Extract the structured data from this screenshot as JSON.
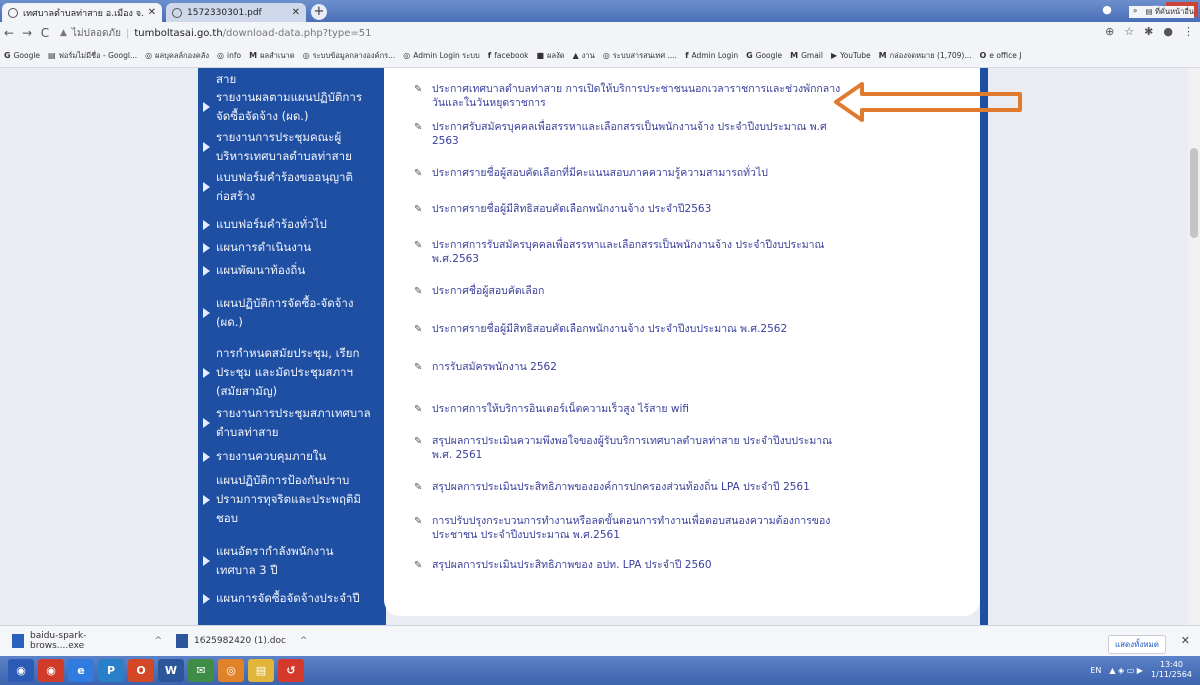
{
  "browser": {
    "tabs": [
      {
        "title": "เทศบาลตำบลท่าสาย อ.เมือง จ.เชียงราย",
        "active": true
      },
      {
        "title": "1572330301.pdf",
        "active": false
      }
    ],
    "new_tab": "+",
    "window_controls": {
      "minimize": "–",
      "maximize": "□",
      "close": "✕"
    },
    "toolbar": {
      "back": "←",
      "forward": "→",
      "reload": "C",
      "warning": "▲",
      "not_secure": "ไม่ปลอดภัย",
      "separator": "|",
      "url_host": "tumboltasai.go.th",
      "url_path": "/download-data.php?type=51",
      "icons": [
        "⊕",
        "☆",
        "✱",
        "●",
        "⋮"
      ]
    },
    "bookmarks": [
      {
        "icon": "G",
        "label": "Google"
      },
      {
        "icon": "▤",
        "label": "ฟอร์มไม่มีชื่อ - Googl..."
      },
      {
        "icon": "◎",
        "label": "ผลบุคลล์กองคลัง"
      },
      {
        "icon": "◎",
        "label": "info"
      },
      {
        "icon": "M",
        "label": "ผลสำเนาด"
      },
      {
        "icon": "◎",
        "label": "ระบบข้อมูลกลางองค์กร..."
      },
      {
        "icon": "◎",
        "label": "Admin Login ระบบ"
      },
      {
        "icon": "f",
        "label": "facebook"
      },
      {
        "icon": "■",
        "label": "ผลงัด"
      },
      {
        "icon": "▲",
        "label": "งาน"
      },
      {
        "icon": "◎",
        "label": "ระบบสารสนเทศ ...."
      },
      {
        "icon": "f",
        "label": "Admin Login"
      },
      {
        "icon": "G",
        "label": "Google"
      },
      {
        "icon": "M",
        "label": "Gmail"
      },
      {
        "icon": "▶",
        "label": "YouTube"
      },
      {
        "icon": "M",
        "label": "กล่องจดหมาย (1,709)..."
      },
      {
        "icon": "O",
        "label": "e office J"
      }
    ],
    "bookmarks_more": "»",
    "bookmarks_other": "▤ ที่คั่นหน้าอื่น"
  },
  "sidebar": {
    "items": [
      {
        "lines": [
          "สาย"
        ],
        "arrow": false
      },
      {
        "lines": [
          "รายงานผลตามแผนปฏิบัติการ",
          "จัดซื้อจัดจ้าง (ผด.)"
        ],
        "arrow": true
      },
      {
        "lines": [
          "รายงานการประชุมคณะผู้",
          "บริหารเทศบาลตำบลท่าสาย"
        ],
        "arrow": true
      },
      {
        "lines": [
          "แบบฟอร์มคำร้องขออนุญาติ",
          "ก่อสร้าง"
        ],
        "arrow": true
      },
      {
        "lines": [
          "แบบฟอร์มคำร้องทั่วไป"
        ],
        "arrow": true
      },
      {
        "lines": [
          "แผนการดำเนินงาน"
        ],
        "arrow": true
      },
      {
        "lines": [
          "แผนพัฒนาท้องถิ่น"
        ],
        "arrow": true
      },
      {
        "lines": [
          "แผนปฏิบัติการจัดซื้อ-จัดจ้าง",
          "(ผด.)"
        ],
        "arrow": true
      },
      {
        "lines": [
          "การกำหนดสมัยประชุม, เรียก",
          "ประชุม และมัดประชุมสภาฯ",
          "(สมัยสามัญ)"
        ],
        "arrow": true
      },
      {
        "lines": [
          "รายงานการประชุมสภาเทศบาล",
          "ตำบลท่าสาย"
        ],
        "arrow": true
      },
      {
        "lines": [
          "รายงานควบคุมภายใน"
        ],
        "arrow": true
      },
      {
        "lines": [
          "แผนปฏิบัติการป้องกันปราบ",
          "ปรามการทุจริตและประพฤติมิ",
          "ชอบ"
        ],
        "arrow": true
      },
      {
        "lines": [
          "แผนอัตรากำลังพนักงาน",
          "เทศบาล 3 ปี"
        ],
        "arrow": true
      },
      {
        "lines": [
          "แผนการจัดซื้อจัดจ้างประจำปี"
        ],
        "arrow": true
      }
    ]
  },
  "announcements": {
    "edit_icon": "✎",
    "items": [
      "ประกาศเทศบาลตำบลท่าสาย การเปิดให้บริการประชาชนนอกเวลาราชการและช่วงพักกลางวันและในวันหยุดราชการ",
      "ประกาศรับสมัครบุคคลเพื่อสรรหาและเลือกสรรเป็นพนักงานจ้าง ประจำปีงบประมาณ พ.ศ 2563",
      "ประกาศรายชื่อผู้สอบคัดเลือกที่มีคะแนนสอบภาคความรู้ความสามารถทั่วไป",
      "ประกาศรายชื่อผู้มีสิทธิสอบคัดเลือกพนักงานจ้าง ประจำปี2563",
      "ประกาศการรับสมัครบุคคลเพื่อสรรหาและเลือกสรรเป็นพนักงานจ้าง ประจำปีงบประมาณ พ.ศ.2563",
      "ประกาศชื่อผู้สอบคัดเลือก",
      "ประกาศรายชื่อผู้มีสิทธิสอบคัดเลือกพนักงานจ้าง ประจำปีงบประมาณ พ.ศ.2562",
      "การรับสมัครพนักงาน 2562",
      "ประกาศการให้บริการอินเตอร์เน็ตความเร็วสูง ไร้สาย wifi",
      "สรุปผลการประเมินความพึงพอใจของผู้รับบริการเทศบาลตำบลท่าสาย ประจำปีงบประมาณ พ.ศ. 2561",
      "สรุปผลการประเมินประสิทธิภาพขององค์การปกครองส่วนท้องถิ่น LPA ประจำปี 2561",
      "การปรับปรุงกระบวนการทำงานหรือลดขั้นตอนการทำงานเพื่อตอบสนองความต้องการของประชาชน ประจำปีงบประมาณ พ.ศ.2561",
      "สรุปผลการประเมินประสิทธิภาพของ อปท. LPA ประจำปี 2560"
    ]
  },
  "downloads": {
    "items": [
      {
        "name": "baidu-spark-brows....exe"
      },
      {
        "name": "1625982420 (1).doc"
      }
    ],
    "chevron": "^",
    "show_all": "แสดงทั้งหมด",
    "close": "✕"
  },
  "taskbar": {
    "apps": [
      {
        "label": "◉",
        "color": "#2c5bb5"
      },
      {
        "label": "◉",
        "color": "#d13b2a"
      },
      {
        "label": "e",
        "color": "#2f7be0"
      },
      {
        "label": "P",
        "color": "#2a7fc9"
      },
      {
        "label": "O",
        "color": "#d24726"
      },
      {
        "label": "W",
        "color": "#2b579a"
      },
      {
        "label": "✉",
        "color": "#3f8c46"
      },
      {
        "label": "◎",
        "color": "#e0822a"
      },
      {
        "label": "▤",
        "color": "#e0b53a"
      },
      {
        "label": "↺",
        "color": "#d4392c"
      }
    ],
    "tray": {
      "lang": "EN",
      "icons": "▲ ◈ ▭ ▶",
      "time": "13:40",
      "date": "1/11/2564"
    }
  },
  "colors": {
    "sidebar": "#1f4fa3",
    "link_text": "#3a3f9c",
    "arrow_outline": "#e07a2e"
  }
}
